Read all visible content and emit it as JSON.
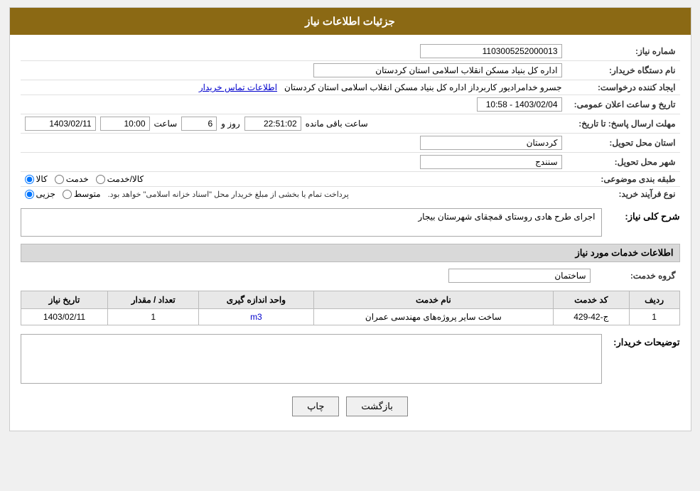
{
  "header": {
    "title": "جزئیات اطلاعات نیاز"
  },
  "sections": {
    "info_title": "جزئیات اطلاعات نیاز",
    "services_title": "اطلاعات خدمات مورد نیاز"
  },
  "fields": {
    "tender_number_label": "شماره نیاز:",
    "tender_number_value": "1103005252000013",
    "org_name_label": "نام دستگاه خریدار:",
    "org_name_value": "اداره کل بنیاد مسکن انقلاب اسلامی استان کردستان",
    "requester_label": "ایجاد کننده درخواست:",
    "requester_value": "جسرو خدامرادیور کاربرداز اداره کل بنیاد مسکن انقلاب اسلامی استان کردستان",
    "requester_link": "اطلاعات تماس خریدار",
    "announce_date_label": "تاریخ و ساعت اعلان عمومی:",
    "announce_date_value": "1403/02/04 - 10:58",
    "deadline_label": "مهلت ارسال پاسخ: تا تاریخ:",
    "deadline_date": "1403/02/11",
    "deadline_time_label": "ساعت",
    "deadline_time": "10:00",
    "deadline_day_label": "روز و",
    "deadline_day": "6",
    "deadline_remaining_label": "ساعت باقی مانده",
    "deadline_remaining": "22:51:02",
    "province_label": "استان محل تحویل:",
    "province_value": "کردستان",
    "city_label": "شهر محل تحویل:",
    "city_value": "سنندج",
    "category_label": "طبقه بندی موضوعی:",
    "category_options": [
      "کالا",
      "خدمت",
      "کالا/خدمت"
    ],
    "category_selected": "کالا",
    "purchase_type_label": "نوع فرآیند خرید:",
    "purchase_options": [
      "جزیی",
      "متوسط"
    ],
    "purchase_note": "پرداخت تمام یا بخشی از مبلغ خریدار محل \"اسناد خزانه اسلامی\" خواهد بود.",
    "description_label": "شرح کلی نیاز:",
    "description_value": "اجرای طرح هادی روستای قمچقای شهرستان بیجار",
    "service_group_label": "گروه خدمت:",
    "service_group_value": "ساختمان"
  },
  "table": {
    "headers": [
      "ردیف",
      "کد خدمت",
      "نام خدمت",
      "واحد اندازه گیری",
      "تعداد / مقدار",
      "تاریخ نیاز"
    ],
    "rows": [
      {
        "row_num": "1",
        "service_code": "ج-42-429",
        "service_name": "ساخت سایر پروژه‌های مهندسی عمران",
        "unit": "m3",
        "quantity": "1",
        "date": "1403/02/11"
      }
    ]
  },
  "buyer_notes_label": "توضیحات خریدار:",
  "buyer_notes_value": "",
  "buttons": {
    "print_label": "چاپ",
    "back_label": "بازگشت"
  }
}
